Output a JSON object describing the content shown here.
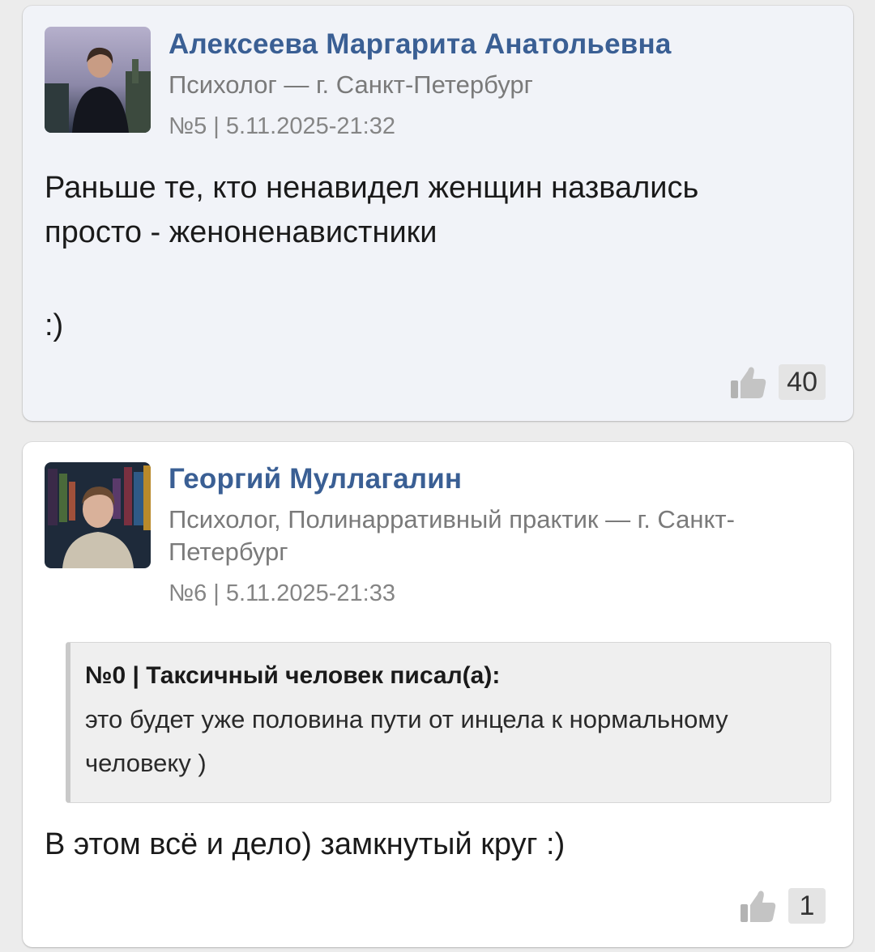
{
  "comments": [
    {
      "author": "Алексеева Маргарита Анатольевна",
      "role": "Психолог — г. Санкт-Петербург",
      "post_info": "№5 | 5.11.2025-21:32",
      "text_line1": "Раньше те, кто ненавидел женщин назвались",
      "text_line2": "просто - женоненавистники",
      "text_line3": ":)",
      "likes": "40",
      "avatar_icon": "user-photo-icon",
      "like_icon": "thumbs-up-icon"
    },
    {
      "author": "Георгий Муллагалин",
      "role": "Психолог, Полинарративный практик — г. Санкт-Петербург",
      "post_info": "№6 | 5.11.2025-21:33",
      "quote": {
        "header": "№0 | Таксичный человек писал(а):",
        "text": "это будет уже половина пути от инцела к нормальному человеку )"
      },
      "text": "В этом всё и дело) замкнутый круг :)",
      "likes": "1",
      "avatar_icon": "user-photo-icon",
      "like_icon": "thumbs-up-icon"
    }
  ],
  "colors": {
    "author": "#3a5f94",
    "card_highlight": "#f1f3f8",
    "background": "#ececec"
  }
}
